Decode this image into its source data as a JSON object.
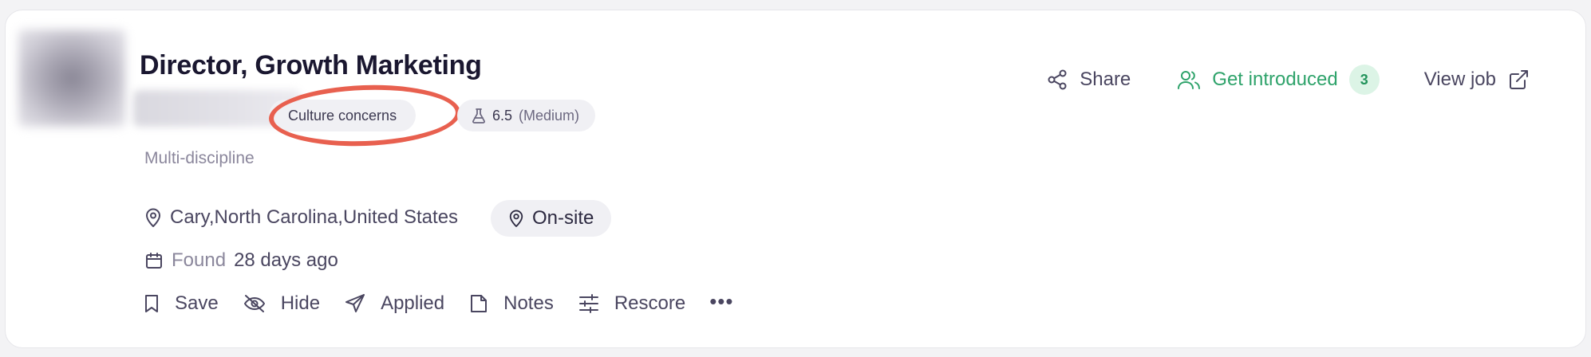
{
  "job": {
    "title": "Director, Growth Marketing",
    "category": "Multi-discipline",
    "location": "Cary,North Carolina,United States",
    "work_mode": "On-site",
    "found_label": "Found",
    "found_value": "28 days ago"
  },
  "badges": {
    "culture": "Culture concerns",
    "score": "6.5",
    "score_level": "(Medium)"
  },
  "top_actions": {
    "share": "Share",
    "get_introduced": "Get introduced",
    "intro_count": "3",
    "view_job": "View job"
  },
  "actions": {
    "save": "Save",
    "hide": "Hide",
    "applied": "Applied",
    "notes": "Notes",
    "rescore": "Rescore",
    "more": "•••"
  },
  "colors": {
    "accent_green": "#2fa36b",
    "annotation_red": "#e8604f",
    "title": "#1a1730"
  },
  "icons": [
    "share-icon",
    "users-icon",
    "external-link-icon",
    "flask-icon",
    "map-pin-icon",
    "calendar-icon",
    "bookmark-icon",
    "eye-off-icon",
    "send-icon",
    "note-icon",
    "sliders-icon"
  ]
}
